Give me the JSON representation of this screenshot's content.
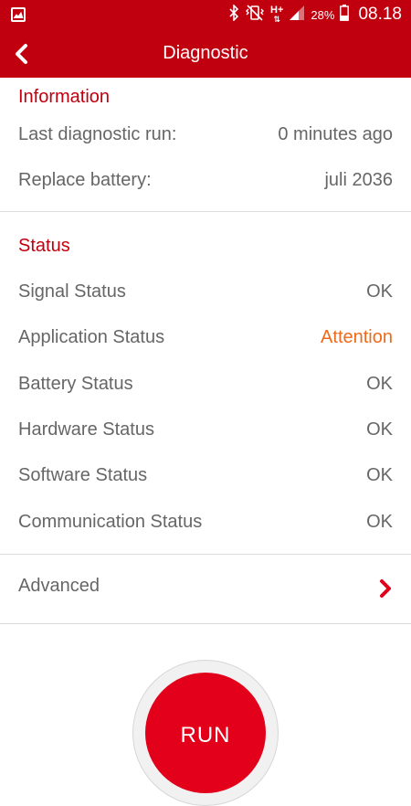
{
  "status_bar": {
    "battery_percent": "28%",
    "time": "08.18",
    "network": "H+"
  },
  "app_bar": {
    "title": "Diagnostic"
  },
  "information": {
    "title": "Information",
    "rows": [
      {
        "label": "Last diagnostic run:",
        "value": "0 minutes ago"
      },
      {
        "label": "Replace battery:",
        "value": "juli 2036"
      }
    ]
  },
  "status": {
    "title": "Status",
    "rows": [
      {
        "label": "Signal Status",
        "value": "OK"
      },
      {
        "label": "Application Status",
        "value": "Attention"
      },
      {
        "label": "Battery Status",
        "value": "OK"
      },
      {
        "label": "Hardware Status",
        "value": "OK"
      },
      {
        "label": "Software Status",
        "value": "OK"
      },
      {
        "label": "Communication Status",
        "value": "OK"
      }
    ]
  },
  "advanced": {
    "label": "Advanced"
  },
  "run_button": {
    "label": "RUN"
  },
  "colors": {
    "brand_red": "#c0000e",
    "attention_orange": "#ee6a1a",
    "text_gray": "#666666"
  }
}
